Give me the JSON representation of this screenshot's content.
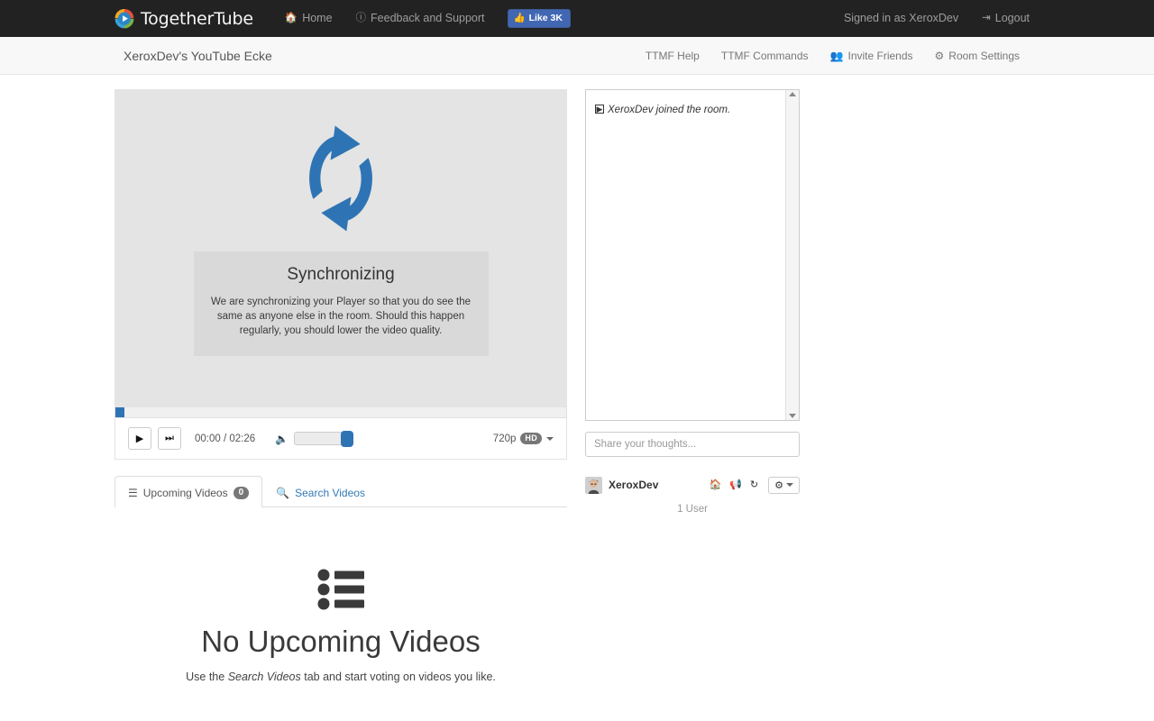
{
  "navbar": {
    "brand": "TogetherTube",
    "brand_logo_icon": "play-emblem-logo",
    "links": [
      {
        "label": "Home",
        "icon": "home-icon"
      },
      {
        "label": "Feedback and Support",
        "icon": "question-circle-icon"
      }
    ],
    "like_button": {
      "label": "Like 3K",
      "icon": "thumbs-up-icon",
      "color": "#4267b2"
    },
    "signed_in_as": "Signed in as XeroxDev",
    "logout": {
      "label": "Logout",
      "icon": "sign-out-icon"
    }
  },
  "roombar": {
    "title": "XeroxDev's YouTube Ecke",
    "links": [
      {
        "label": "TTMF Help",
        "icon": ""
      },
      {
        "label": "TTMF Commands",
        "icon": ""
      },
      {
        "label": "Invite Friends",
        "icon": "users-icon"
      },
      {
        "label": "Room Settings",
        "icon": "gear-icon"
      }
    ]
  },
  "player": {
    "sync_icon": "refresh-arrows-icon",
    "sync_title": "Synchronizing",
    "sync_description": "We are synchronizing your Player so that you do see the same as anyone else in the room. Should this happen regularly, you should lower the video quality.",
    "progress_percent": 2,
    "controls": {
      "play_icon": "play-icon",
      "next_icon": "skip-forward-icon",
      "time": "00:00 / 02:26",
      "current_time": "00:00",
      "duration": "02:26",
      "volume_icon": "volume-icon",
      "volume_percent": 97,
      "quality_label": "720p",
      "quality_badge": "HD",
      "quality_caret_icon": "caret-down-icon"
    }
  },
  "tabs": [
    {
      "label": "Upcoming Videos",
      "icon": "list-icon",
      "badge": "0",
      "active": true
    },
    {
      "label": "Search Videos",
      "icon": "search-icon",
      "badge": "",
      "active": false
    }
  ],
  "empty_state": {
    "icon": "list-ul-icon",
    "title": "No Upcoming Videos",
    "sub_prefix": "Use the ",
    "sub_emphasis": "Search Videos",
    "sub_suffix": " tab and start voting on videos you like."
  },
  "chat": {
    "messages": [
      {
        "icon": "play-box-icon",
        "text": "XeroxDev joined the room."
      }
    ],
    "input_placeholder": "Share your thoughts...",
    "input_value": "",
    "scrollbar_up_icon": "scroll-up-arrow-icon",
    "scrollbar_down_icon": "scroll-down-arrow-icon"
  },
  "users": {
    "list": [
      {
        "name": "XeroxDev",
        "avatar_icon": "user-avatar",
        "actions": [
          {
            "icon": "home-icon",
            "name": "make-host"
          },
          {
            "icon": "bullhorn-icon",
            "name": "megaphone"
          },
          {
            "icon": "sync-icon",
            "name": "resync"
          }
        ],
        "gear_icon": "gear-icon",
        "gear_caret_icon": "caret-down-icon"
      }
    ],
    "count_label": "1 User"
  },
  "colors": {
    "navbar_bg": "#222222",
    "accent_blue": "#2e74b5",
    "link_blue": "#337ab7",
    "facebook_blue": "#4267b2",
    "video_bg": "#e4e4e4",
    "sync_box_bg": "#d9d9d9"
  }
}
